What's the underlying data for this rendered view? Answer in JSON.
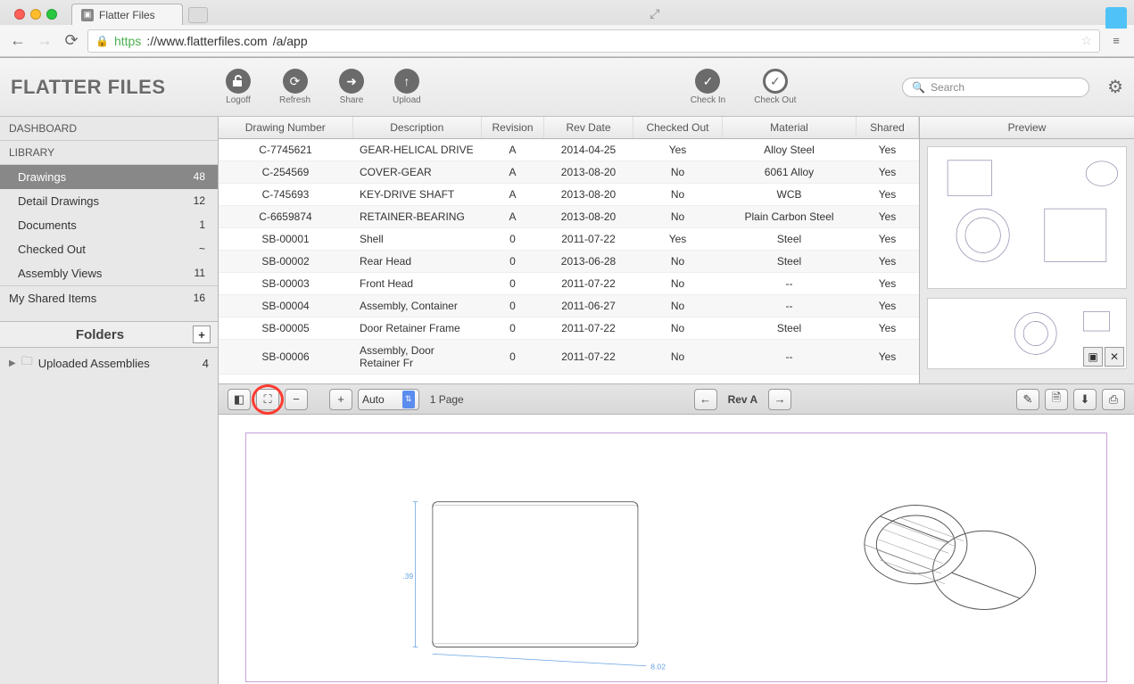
{
  "browser": {
    "tab_title": "Flatter Files",
    "url_protocol": "https",
    "url_host": "://www.flatterfiles.com",
    "url_path": "/a/app"
  },
  "app": {
    "title": "FLATTER FILES",
    "toolbar": {
      "logoff": "Logoff",
      "refresh": "Refresh",
      "share": "Share",
      "upload": "Upload",
      "checkin": "Check In",
      "checkout": "Check Out"
    },
    "search_placeholder": "Search"
  },
  "sidebar": {
    "dashboard": "DASHBOARD",
    "library": "LIBRARY",
    "items": [
      {
        "label": "Drawings",
        "count": "48",
        "active": true
      },
      {
        "label": "Detail Drawings",
        "count": "12"
      },
      {
        "label": "Documents",
        "count": "1"
      },
      {
        "label": "Checked Out",
        "count": "~"
      },
      {
        "label": "Assembly Views",
        "count": "11"
      }
    ],
    "shared": {
      "label": "My Shared Items",
      "count": "16"
    },
    "folders_head": "Folders",
    "folder": {
      "label": "Uploaded Assemblies",
      "count": "4"
    }
  },
  "table": {
    "headers": [
      "Drawing Number",
      "Description",
      "Revision",
      "Rev Date",
      "Checked Out",
      "Material",
      "Shared"
    ],
    "rows": [
      [
        "C-7745621",
        "GEAR-HELICAL DRIVE",
        "A",
        "2014-04-25",
        "Yes",
        "Alloy Steel",
        "Yes"
      ],
      [
        "C-254569",
        "COVER-GEAR",
        "A",
        "2013-08-20",
        "No",
        "6061 Alloy",
        "Yes"
      ],
      [
        "C-745693",
        "KEY-DRIVE SHAFT",
        "A",
        "2013-08-20",
        "No",
        "WCB",
        "Yes"
      ],
      [
        "C-6659874",
        "RETAINER-BEARING",
        "A",
        "2013-08-20",
        "No",
        "Plain Carbon Steel",
        "Yes"
      ],
      [
        "SB-00001",
        "Shell",
        "0",
        "2011-07-22",
        "Yes",
        "Steel",
        "Yes"
      ],
      [
        "SB-00002",
        "Rear Head",
        "0",
        "2013-06-28",
        "No",
        "Steel",
        "Yes"
      ],
      [
        "SB-00003",
        "Front Head",
        "0",
        "2011-07-22",
        "No",
        "--",
        "Yes"
      ],
      [
        "SB-00004",
        "Assembly, Container",
        "0",
        "2011-06-27",
        "No",
        "--",
        "Yes"
      ],
      [
        "SB-00005",
        "Door Retainer Frame",
        "0",
        "2011-07-22",
        "No",
        "Steel",
        "Yes"
      ],
      [
        "SB-00006",
        "Assembly, Door Retainer Fr",
        "0",
        "2011-07-22",
        "No",
        "--",
        "Yes"
      ]
    ]
  },
  "preview": {
    "title": "Preview"
  },
  "viewer": {
    "zoom_mode": "Auto",
    "page_info": "1 Page",
    "revision": "Rev A",
    "dim1": ".39",
    "dim2": "8.02"
  }
}
